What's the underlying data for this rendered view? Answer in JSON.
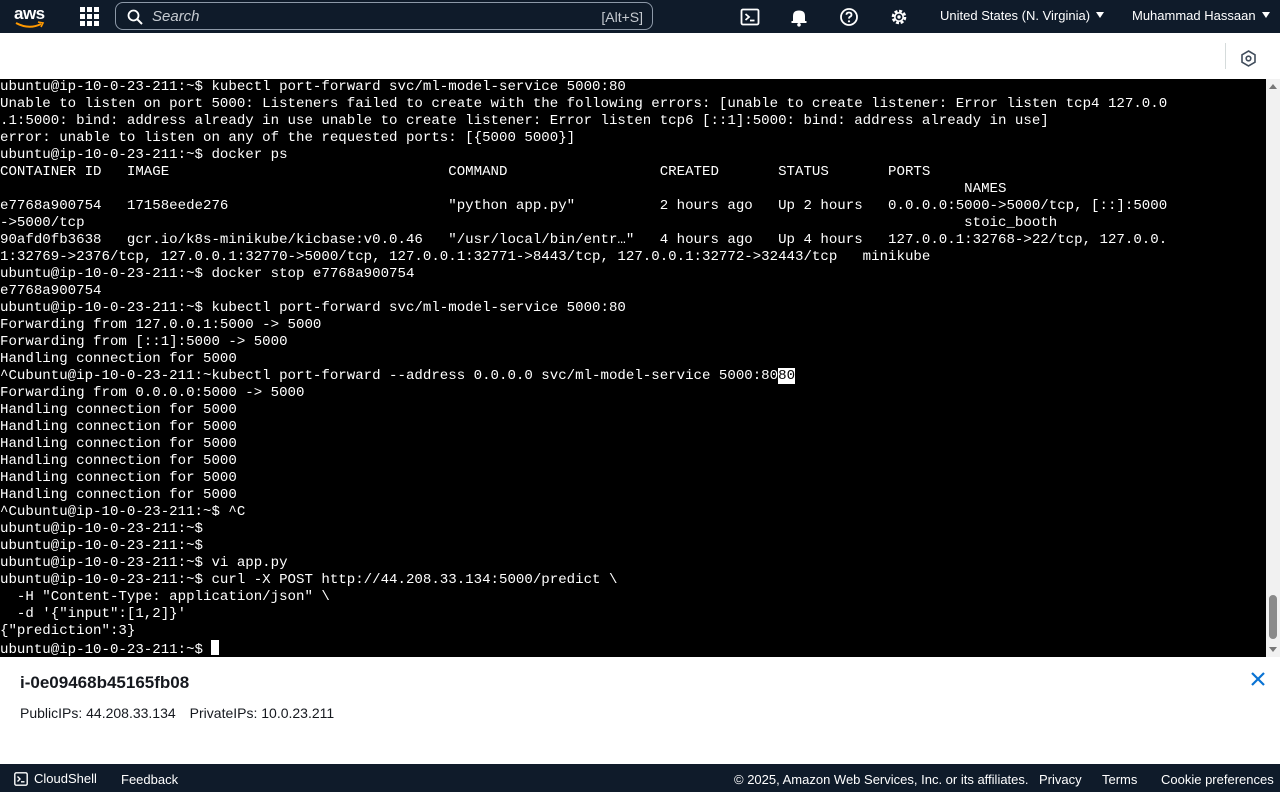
{
  "nav": {
    "logo_text": "aws",
    "search_placeholder": "Search",
    "search_shortcut": "[Alt+S]",
    "region": "United States (N. Virginia)",
    "user": "Muhammad Hassaan",
    "icons": [
      "services-grid-icon",
      "search-icon",
      "cloudshell-icon",
      "bell-icon",
      "help-icon",
      "gear-icon"
    ]
  },
  "terminal": {
    "lines": [
      "ubuntu@ip-10-0-23-211:~$ kubectl port-forward svc/ml-model-service 5000:80",
      "Unable to listen on port 5000: Listeners failed to create with the following errors: [unable to create listener: Error listen tcp4 127.0.0",
      ".1:5000: bind: address already in use unable to create listener: Error listen tcp6 [::1]:5000: bind: address already in use]",
      "error: unable to listen on any of the requested ports: [{5000 5000}]",
      "ubuntu@ip-10-0-23-211:~$ docker ps",
      "CONTAINER ID   IMAGE                                 COMMAND                  CREATED       STATUS       PORTS",
      "                                                                                                                  NAMES",
      "e7768a900754   17158eede276                          \"python app.py\"          2 hours ago   Up 2 hours   0.0.0.0:5000->5000/tcp, [::]:5000",
      "->5000/tcp                                                                                                        stoic_booth",
      "90afd0fb3638   gcr.io/k8s-minikube/kicbase:v0.0.46   \"/usr/local/bin/entr…\"   4 hours ago   Up 4 hours   127.0.0.1:32768->22/tcp, 127.0.0.",
      "1:32769->2376/tcp, 127.0.0.1:32770->5000/tcp, 127.0.0.1:32771->8443/tcp, 127.0.0.1:32772->32443/tcp   minikube",
      "ubuntu@ip-10-0-23-211:~$ docker stop e7768a900754",
      "e7768a900754",
      "ubuntu@ip-10-0-23-211:~$ kubectl port-forward svc/ml-model-service 5000:80",
      "Forwarding from 127.0.0.1:5000 -> 5000",
      "Forwarding from [::1]:5000 -> 5000",
      "Handling connection for 5000",
      "^Cubuntu@ip-10-0-23-211:~kubectl port-forward --address 0.0.0.0 svc/ml-model-service 5000:80",
      "Forwarding from 0.0.0.0:5000 -> 5000",
      "Handling connection for 5000",
      "Handling connection for 5000",
      "Handling connection for 5000",
      "Handling connection for 5000",
      "Handling connection for 5000",
      "Handling connection for 5000",
      "^Cubuntu@ip-10-0-23-211:~$ ^C",
      "ubuntu@ip-10-0-23-211:~$",
      "ubuntu@ip-10-0-23-211:~$",
      "ubuntu@ip-10-0-23-211:~$ vi app.py",
      "ubuntu@ip-10-0-23-211:~$ curl -X POST http://44.208.33.134:5000/predict \\",
      "  -H \"Content-Type: application/json\" \\",
      "  -d '{\"input\":[1,2]}'",
      "{\"prediction\":3}"
    ],
    "highlighted_text": "80",
    "prompt": "ubuntu@ip-10-0-23-211:~$ "
  },
  "instance": {
    "id": "i-0e09468b45165fb08",
    "public_ips": "PublicIPs: 44.208.33.134",
    "private_ips": "PrivateIPs: 10.0.23.211"
  },
  "footer": {
    "cloudshell": "CloudShell",
    "feedback": "Feedback",
    "copyright": "© 2025, Amazon Web Services, Inc. or its affiliates.",
    "privacy": "Privacy",
    "terms": "Terms",
    "cookie": "Cookie preferences"
  },
  "colors": {
    "nav_bg": "#0f1b2a",
    "terminal_bg": "#000000",
    "terminal_fg": "#ffffff",
    "close_icon": "#0972d3"
  }
}
